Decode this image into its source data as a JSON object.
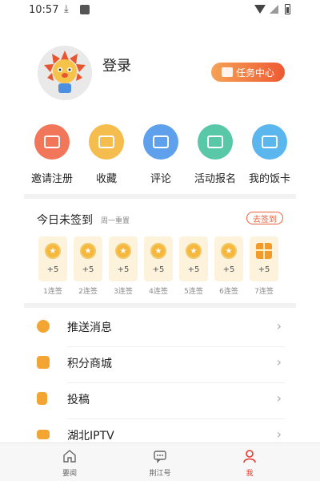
{
  "status_bar": {
    "time": "10:57"
  },
  "profile": {
    "login_text": "登录",
    "task_center": "任务中心"
  },
  "quick_actions": [
    {
      "label": "邀请注册",
      "icon": "envelope-icon",
      "color": "#f2765a"
    },
    {
      "label": "收藏",
      "icon": "bookmark-icon",
      "color": "#f5bd4e"
    },
    {
      "label": "评论",
      "icon": "comment-icon",
      "color": "#5fa0ec"
    },
    {
      "label": "活动报名",
      "icon": "clipboard-icon",
      "color": "#58c8a8"
    },
    {
      "label": "我的饭卡",
      "icon": "card-icon",
      "color": "#5ab6ec"
    }
  ],
  "signin": {
    "title": "今日未签到",
    "subtitle": "周一重置",
    "button": "去签到",
    "days": [
      {
        "points": "+5",
        "label": "1连签"
      },
      {
        "points": "+5",
        "label": "2连签"
      },
      {
        "points": "+5",
        "label": "3连签"
      },
      {
        "points": "+5",
        "label": "4连签"
      },
      {
        "points": "+5",
        "label": "5连签"
      },
      {
        "points": "+5",
        "label": "6连签"
      },
      {
        "points": "+5",
        "label": "7连签"
      }
    ]
  },
  "menu": [
    {
      "label": "推送消息",
      "icon": "push-message-icon",
      "color": "#f3a533"
    },
    {
      "label": "积分商城",
      "icon": "points-mall-icon",
      "color": "#f3a533"
    },
    {
      "label": "投稿",
      "icon": "submit-article-icon",
      "color": "#f3a533"
    },
    {
      "label": "湖北IPTV",
      "icon": "tv-icon",
      "color": "#f3a533"
    }
  ],
  "tabbar": [
    {
      "label": "要闻",
      "icon": "home-icon",
      "active": false
    },
    {
      "label": "荆江号",
      "icon": "chat-icon",
      "active": false
    },
    {
      "label": "我",
      "icon": "user-icon",
      "active": true
    }
  ],
  "colors": {
    "accent": "#e8603c",
    "active_tab": "#e23b2e"
  }
}
